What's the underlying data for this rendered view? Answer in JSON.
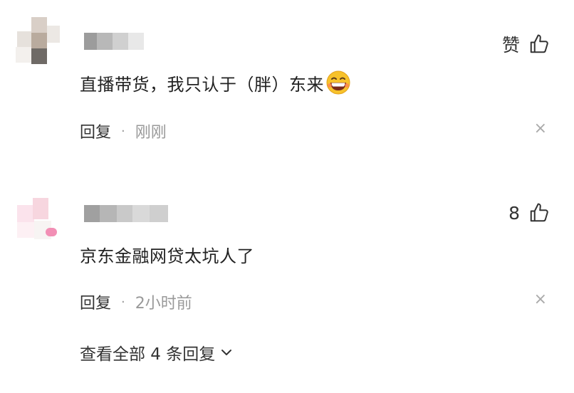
{
  "comments": [
    {
      "text": "直播带货，我只认于（胖）东来",
      "emoji_name": "grinning-face-emoji",
      "like_label": "赞",
      "reply_label": "回复",
      "time": "刚刚",
      "close_glyph": "×"
    },
    {
      "text": "京东金融网贷太坑人了",
      "like_label": "8",
      "reply_label": "回复",
      "time": "2小时前",
      "close_glyph": "×"
    }
  ],
  "separator": "·",
  "view_all_replies": "查看全部 4 条回复",
  "icons": {
    "like": "thumbs-up-icon",
    "close": "close-icon",
    "expand": "chevron-down-icon"
  },
  "colors": {
    "text": "#222222",
    "muted": "#999999",
    "background": "#ffffff"
  }
}
